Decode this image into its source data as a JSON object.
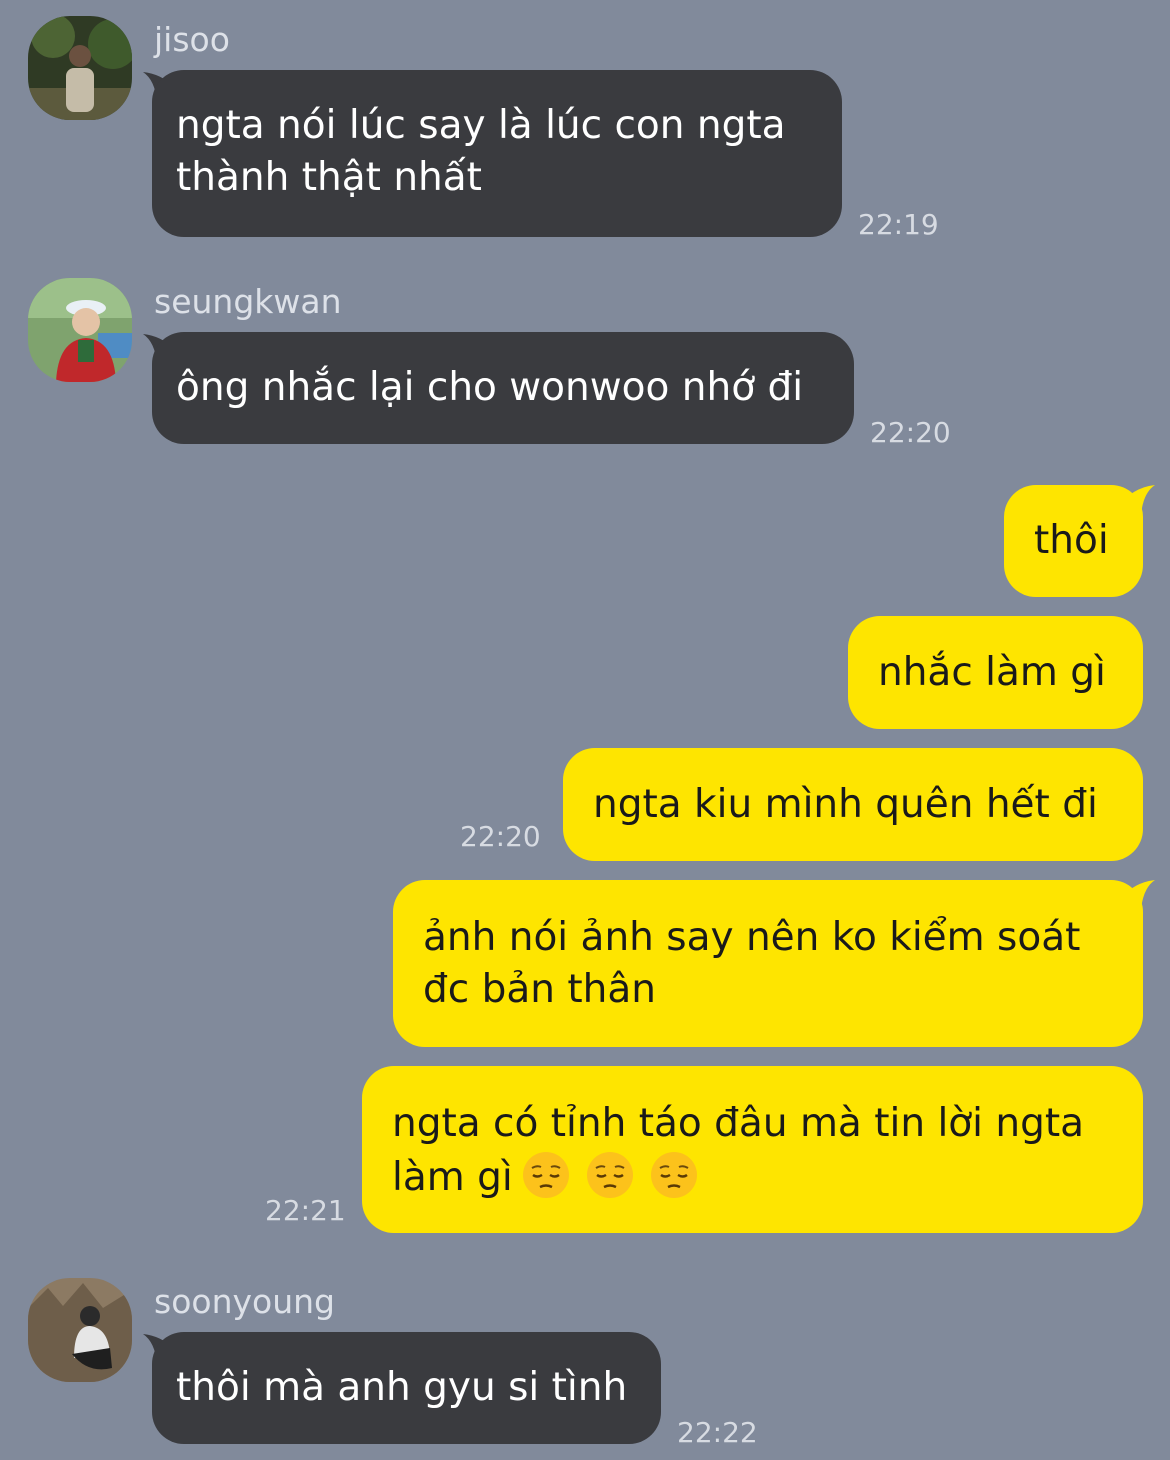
{
  "colors": {
    "background": "#818a9b",
    "incoming_bubble": "#3a3b3f",
    "outgoing_bubble": "#fee500"
  },
  "messages": {
    "m1": {
      "sender": "jisoo",
      "line1": "ngta nói lúc say là lúc con ngta",
      "line2": "thành thật nhất",
      "time": "22:19"
    },
    "m2": {
      "sender": "seungkwan",
      "line1": "ông nhắc lại cho wonwoo nhớ đi",
      "time": "22:20"
    },
    "m3": {
      "line1": "thôi"
    },
    "m4": {
      "line1": "nhắc làm gì"
    },
    "m5": {
      "line1": "ngta kiu mình quên hết đi",
      "time": "22:20"
    },
    "m6": {
      "line1": "ảnh nói ảnh say nên ko kiểm soát",
      "line2": "đc bản thân"
    },
    "m7": {
      "line1": "ngta có tỉnh táo đâu mà tin lời ngta",
      "line2": "làm gì",
      "emoji": "pensive-face",
      "emoji_count": 3,
      "time": "22:21"
    },
    "m8": {
      "sender": "soonyoung",
      "line1": "thôi mà anh gyu si tình",
      "time": "22:22"
    }
  }
}
